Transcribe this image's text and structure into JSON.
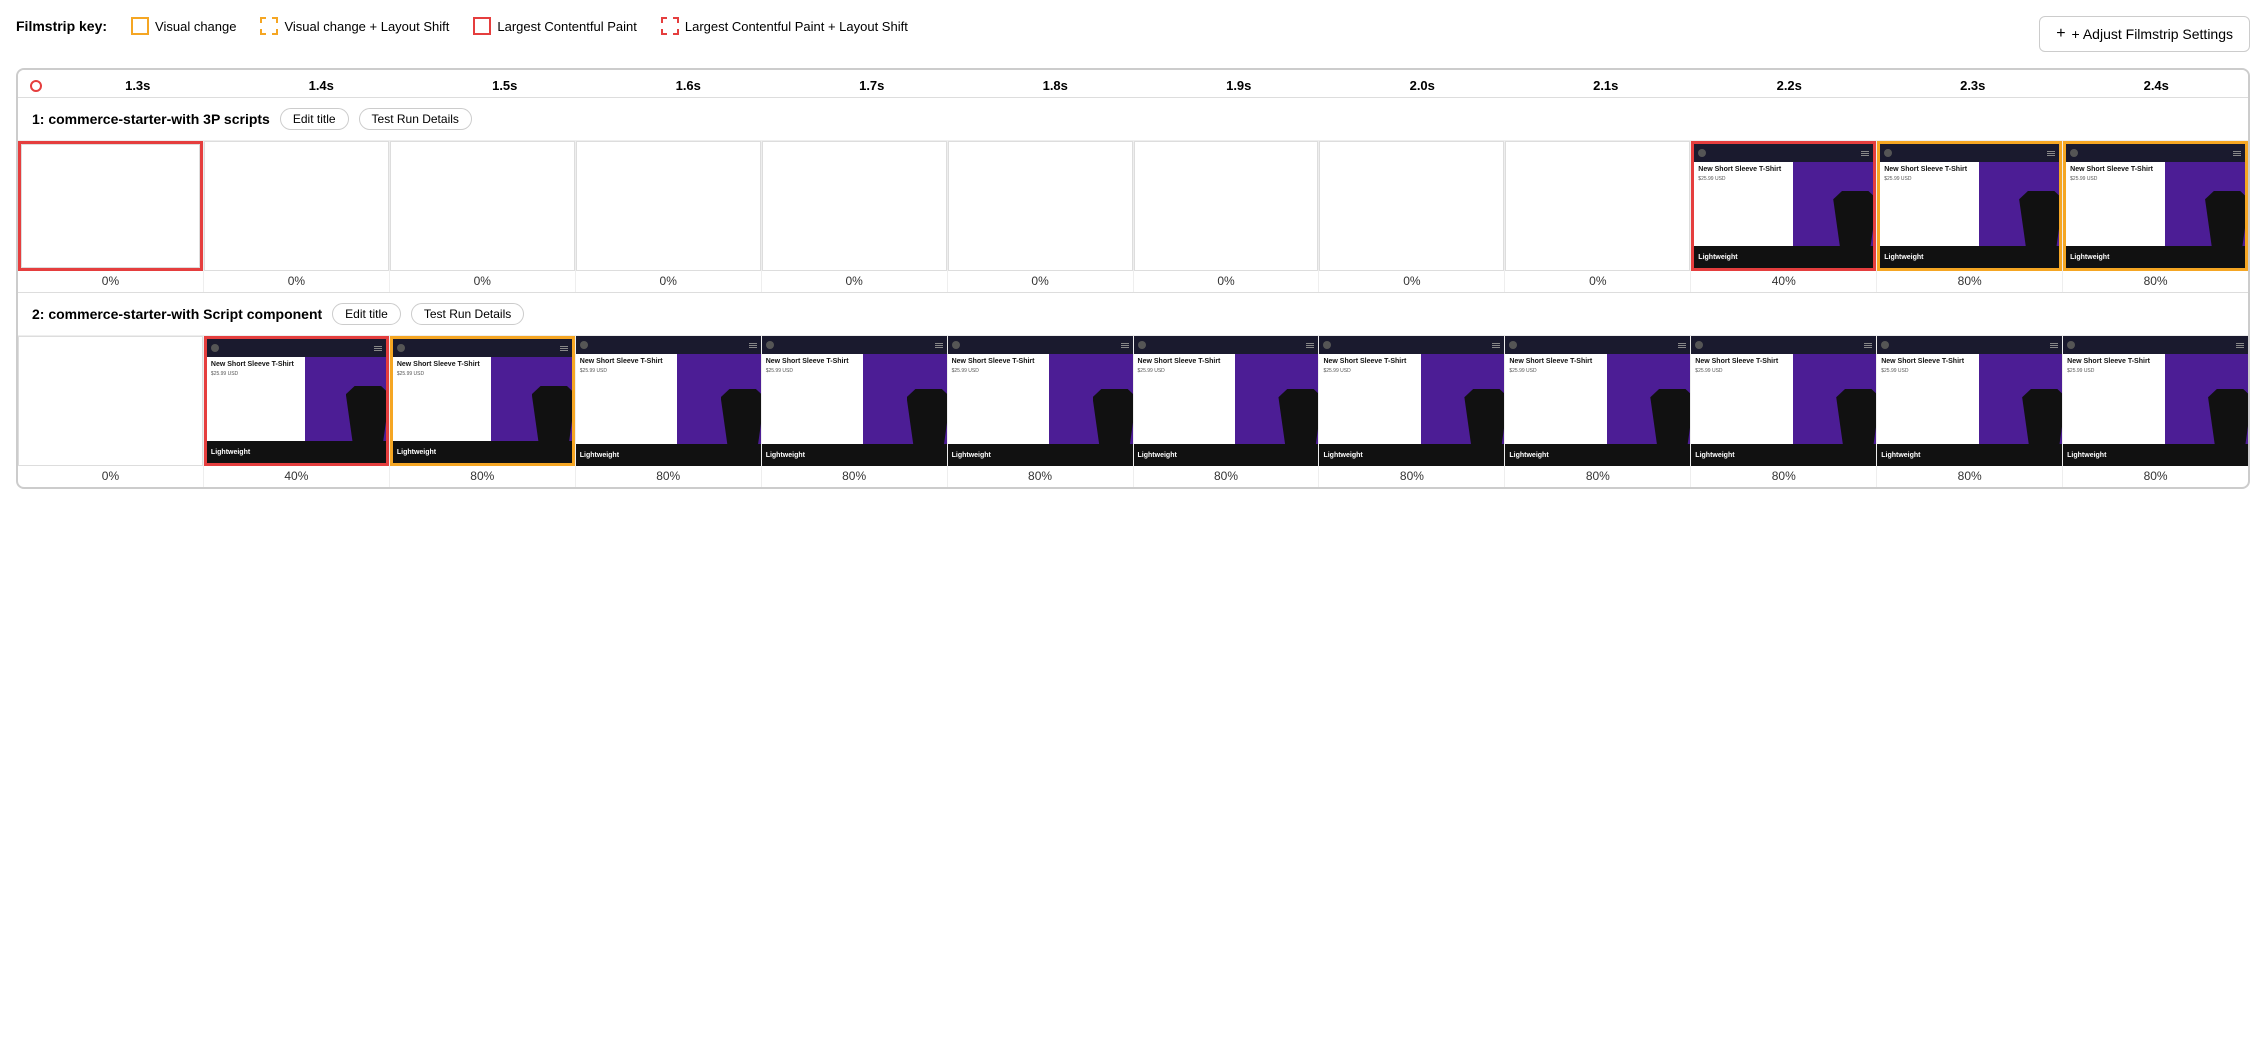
{
  "key": {
    "label": "Filmstrip key:",
    "items": [
      {
        "id": "visual-change",
        "label": "Visual change",
        "borderStyle": "solid-yellow"
      },
      {
        "id": "visual-change-layout",
        "label": "Visual change + Layout Shift",
        "borderStyle": "dashed-yellow"
      },
      {
        "id": "lcp",
        "label": "Largest Contentful Paint",
        "borderStyle": "solid-red"
      },
      {
        "id": "lcp-layout",
        "label": "Largest Contentful Paint + Layout Shift",
        "borderStyle": "dashed-red"
      }
    ]
  },
  "adjustBtn": "+ Adjust Filmstrip Settings",
  "timeline": {
    "ticks": [
      "1.3s",
      "1.4s",
      "1.5s",
      "1.6s",
      "1.7s",
      "1.8s",
      "1.9s",
      "2.0s",
      "2.1s",
      "2.2s",
      "2.3s",
      "2.4s"
    ]
  },
  "tests": [
    {
      "id": "test1",
      "title": "1: commerce-starter-with 3P scripts",
      "editTitleLabel": "Edit title",
      "testRunLabel": "Test Run Details",
      "frames": [
        {
          "pct": "0%",
          "type": "empty",
          "border": "lcp-border"
        },
        {
          "pct": "0%",
          "type": "empty",
          "border": ""
        },
        {
          "pct": "0%",
          "type": "empty",
          "border": ""
        },
        {
          "pct": "0%",
          "type": "empty",
          "border": ""
        },
        {
          "pct": "0%",
          "type": "empty",
          "border": ""
        },
        {
          "pct": "0%",
          "type": "empty",
          "border": ""
        },
        {
          "pct": "0%",
          "type": "empty",
          "border": ""
        },
        {
          "pct": "0%",
          "type": "empty",
          "border": ""
        },
        {
          "pct": "0%",
          "type": "empty",
          "border": ""
        },
        {
          "pct": "40%",
          "type": "thumb",
          "border": "lcp-border"
        },
        {
          "pct": "80%",
          "type": "thumb",
          "border": "visual-border"
        },
        {
          "pct": "80%",
          "type": "thumb",
          "border": "visual-border"
        }
      ]
    },
    {
      "id": "test2",
      "title": "2: commerce-starter-with Script component",
      "editTitleLabel": "Edit title",
      "testRunLabel": "Test Run Details",
      "frames": [
        {
          "pct": "0%",
          "type": "empty",
          "border": ""
        },
        {
          "pct": "40%",
          "type": "thumb",
          "border": "lcp-border"
        },
        {
          "pct": "80%",
          "type": "thumb",
          "border": "visual-border"
        },
        {
          "pct": "80%",
          "type": "thumb",
          "border": ""
        },
        {
          "pct": "80%",
          "type": "thumb",
          "border": ""
        },
        {
          "pct": "80%",
          "type": "thumb",
          "border": ""
        },
        {
          "pct": "80%",
          "type": "thumb",
          "border": ""
        },
        {
          "pct": "80%",
          "type": "thumb",
          "border": ""
        },
        {
          "pct": "80%",
          "type": "thumb",
          "border": ""
        },
        {
          "pct": "80%",
          "type": "thumb",
          "border": ""
        },
        {
          "pct": "80%",
          "type": "thumb",
          "border": ""
        },
        {
          "pct": "80%",
          "type": "thumb",
          "border": ""
        }
      ]
    }
  ],
  "colors": {
    "lcpBorder": "#e53e3e",
    "visualBorder": "#f5a623",
    "purple": "#4c1d95",
    "dark": "#1a1a2e"
  }
}
